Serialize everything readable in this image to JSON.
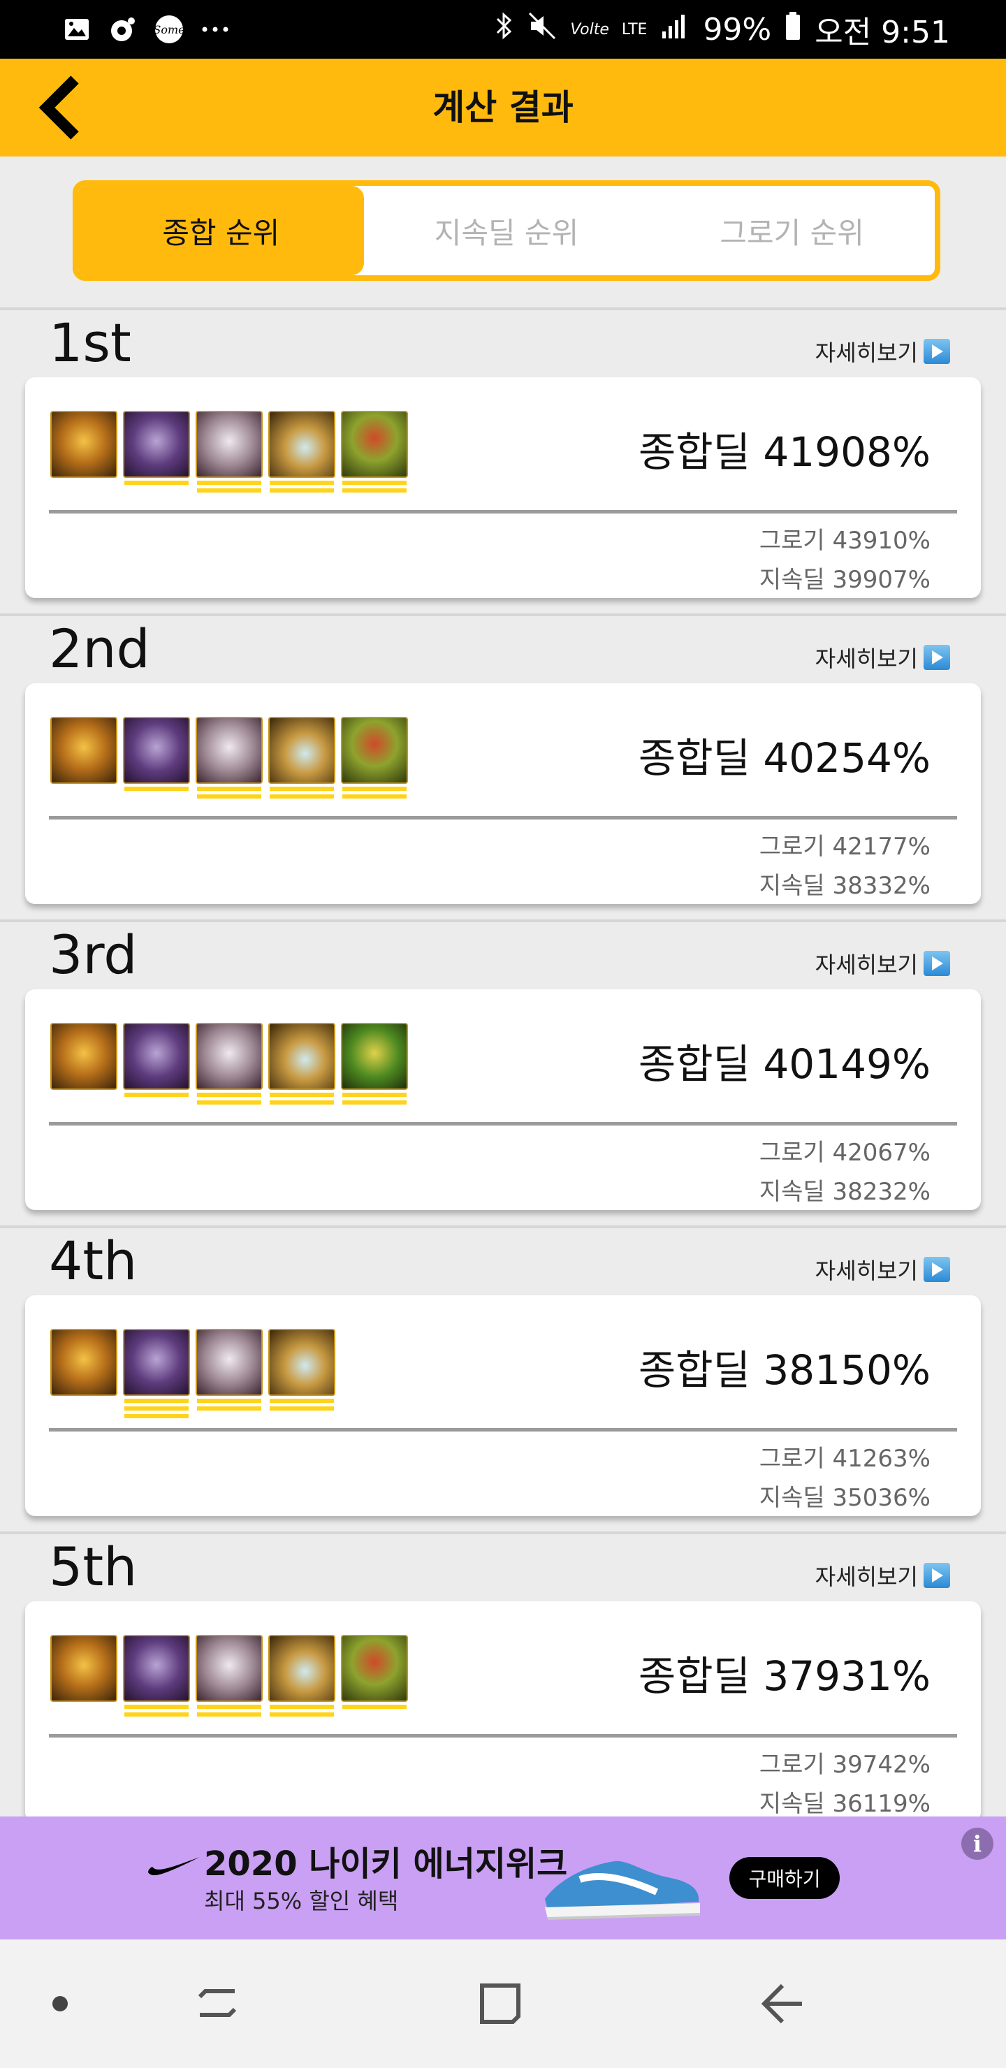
{
  "status_bar": {
    "battery": "99%",
    "time": "오전 9:51",
    "network_volte": "Volte",
    "network_lte": "LTE"
  },
  "app_bar": {
    "title": "계산 결과"
  },
  "tabs": [
    {
      "label": "종합 순위",
      "active": true
    },
    {
      "label": "지속딜 순위",
      "active": false
    },
    {
      "label": "그로기 순위",
      "active": false
    }
  ],
  "detail_label": "자세히보기",
  "results": [
    {
      "rank": "1st",
      "total": "종합딜 41908%",
      "groggy": "그로기 43910%",
      "sustained": "지속딜 39907%",
      "items": [
        {
          "icon": "gold-orb-icon",
          "bars": 0
        },
        {
          "icon": "purple-gear-icon",
          "bars": 1
        },
        {
          "icon": "silver-helm-icon",
          "bars": 2
        },
        {
          "icon": "blade-icon",
          "bars": 2
        },
        {
          "icon": "green-red-emblem-icon",
          "bars": 2
        }
      ]
    },
    {
      "rank": "2nd",
      "total": "종합딜 40254%",
      "groggy": "그로기 42177%",
      "sustained": "지속딜 38332%",
      "items": [
        {
          "icon": "gold-orb-icon",
          "bars": 0
        },
        {
          "icon": "purple-gear-icon",
          "bars": 1
        },
        {
          "icon": "silver-helm-icon",
          "bars": 2
        },
        {
          "icon": "blade-icon",
          "bars": 2
        },
        {
          "icon": "green-red-emblem-icon",
          "bars": 2
        }
      ]
    },
    {
      "rank": "3rd",
      "total": "종합딜 40149%",
      "groggy": "그로기 42067%",
      "sustained": "지속딜 38232%",
      "items": [
        {
          "icon": "gold-orb-icon",
          "bars": 0
        },
        {
          "icon": "purple-gear-icon",
          "bars": 1
        },
        {
          "icon": "silver-helm-icon",
          "bars": 2
        },
        {
          "icon": "blade-icon",
          "bars": 2
        },
        {
          "icon": "green-emblem-icon",
          "bars": 2
        }
      ]
    },
    {
      "rank": "4th",
      "total": "종합딜 38150%",
      "groggy": "그로기 41263%",
      "sustained": "지속딜 35036%",
      "items": [
        {
          "icon": "gold-orb-icon",
          "bars": 0
        },
        {
          "icon": "purple-gear-icon",
          "bars": 3
        },
        {
          "icon": "silver-helm-icon",
          "bars": 2
        },
        {
          "icon": "blade-icon",
          "bars": 2
        }
      ]
    },
    {
      "rank": "5th",
      "total": "종합딜 37931%",
      "groggy": "그로기 39742%",
      "sustained": "지속딜 36119%",
      "items": [
        {
          "icon": "gold-orb-icon",
          "bars": 0
        },
        {
          "icon": "purple-gear-icon",
          "bars": 2
        },
        {
          "icon": "silver-helm-icon",
          "bars": 2
        },
        {
          "icon": "blade-icon",
          "bars": 2
        },
        {
          "icon": "green-red-emblem-icon",
          "bars": 1
        }
      ]
    }
  ],
  "ad": {
    "title": "2020 나이키 에너지위크",
    "subtitle": "최대 55% 할인 혜택",
    "button": "구매하기",
    "info": "i"
  },
  "colors": {
    "accent": "#ffba0d",
    "bar": "#ffd31a",
    "ad_bg": "#c9a0f3"
  }
}
